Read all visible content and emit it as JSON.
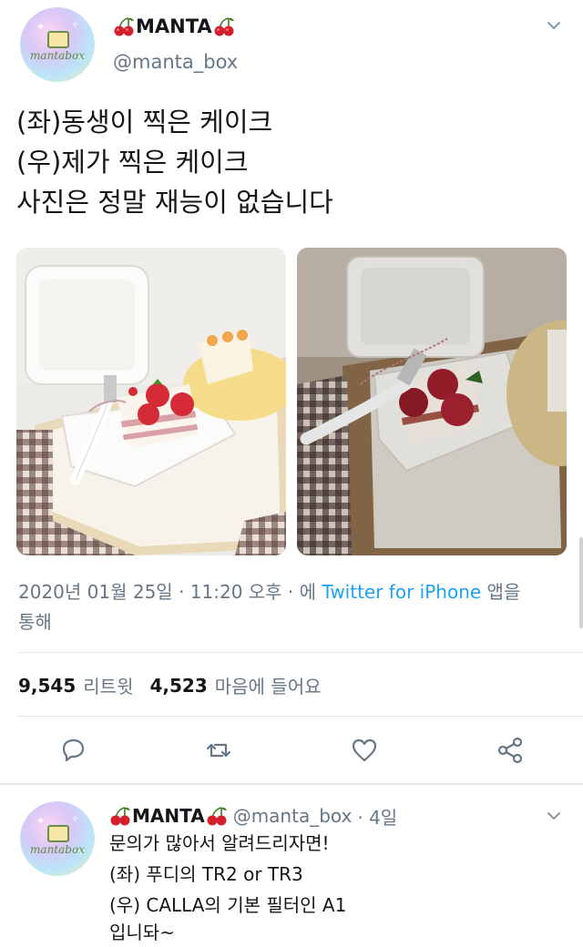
{
  "tweet": {
    "display_name": "MANTA",
    "handle": "@manta_box",
    "avatar_text": "mantabox",
    "lines": [
      "(좌)동생이 찍은 케이크",
      "(우)제가 찍은 케이크",
      "사진은 정말 재능이 없습니다"
    ],
    "timestamp": "2020년 01월 25일 · 11:20 오후 · 에 ",
    "source": "Twitter for iPhone",
    "source_suffix": " 앱을",
    "source_line2": "통해",
    "retweet_count": "9,545",
    "retweet_label": "리트윗",
    "like_count": "4,523",
    "like_label": "마음에 들어요"
  },
  "reply": {
    "display_name": "MANTA",
    "handle": "@manta_box",
    "time": "· 4일",
    "lines": [
      "문의가 많아서 알려드리자면!",
      "(좌) 푸디의 TR2 or TR3",
      "(우) CALLA의 기본 필터인 A1",
      "입니돠~"
    ]
  },
  "icons": [
    "cherry-icon",
    "chevron-down-icon",
    "reply-icon",
    "retweet-icon",
    "like-icon",
    "share-icon"
  ],
  "colors": {
    "text": "#14171a",
    "secondary": "#657786",
    "link": "#1da1f2",
    "divider": "#e1e8ed",
    "cherry": "#d4202c"
  }
}
